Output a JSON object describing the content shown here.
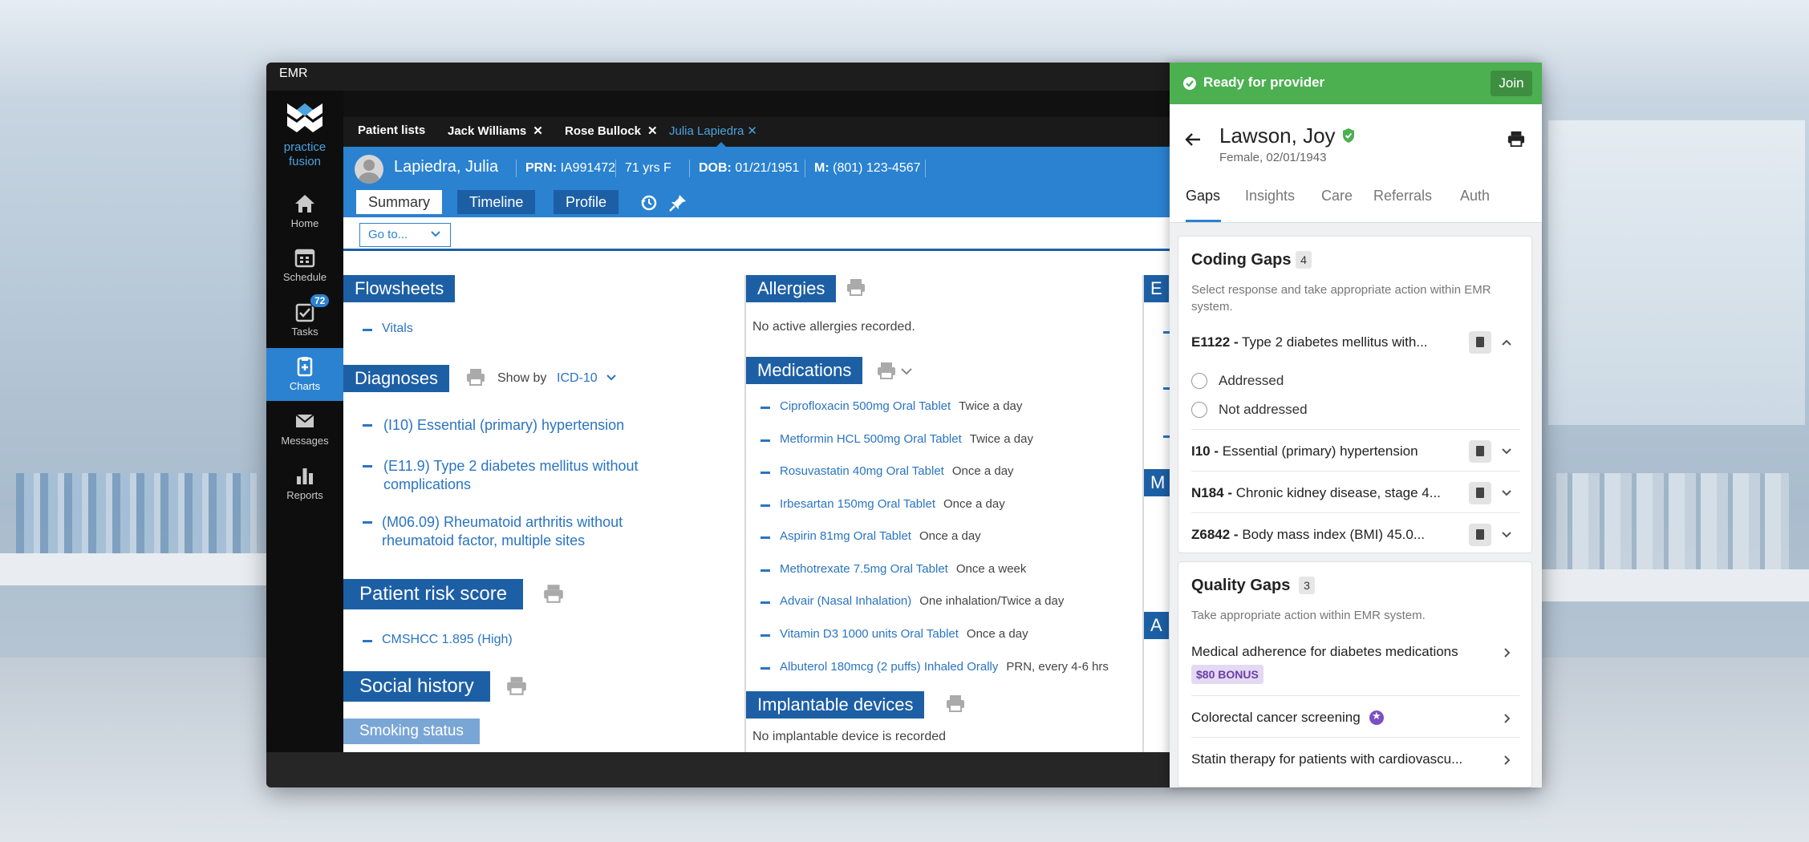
{
  "app": {
    "title": "EMR"
  },
  "logo": {
    "line1": "practice",
    "line2": "fusion"
  },
  "nav": {
    "home": "Home",
    "schedule": "Schedule",
    "tasks": "Tasks",
    "tasks_badge": "72",
    "charts": "Charts",
    "messages": "Messages",
    "reports": "Reports"
  },
  "tabs": [
    {
      "label": "Patient lists"
    },
    {
      "label": "Jack Williams"
    },
    {
      "label": "Rose Bullock"
    },
    {
      "label": "Julia Lapiedra"
    }
  ],
  "patient": {
    "name": "Lapiedra, Julia",
    "prn_label": "PRN:",
    "prn": "IA991472",
    "age": "71 yrs F",
    "dob_label": "DOB:",
    "dob": "01/21/1951",
    "mobile_label": "M:",
    "mobile": "(801) 123-4567"
  },
  "subtabs": {
    "summary": "Summary",
    "timeline": "Timeline",
    "profile": "Profile"
  },
  "goto": {
    "label": "Go to..."
  },
  "flowsheets": {
    "title": "Flowsheets",
    "items": [
      "Vitals"
    ]
  },
  "diagnoses": {
    "title": "Diagnoses",
    "show_by_label": "Show by",
    "show_by_value": "ICD-10",
    "items": [
      {
        "line1": "(I10) Essential (primary) hypertension",
        "line2": ""
      },
      {
        "line1": "(E11.9) Type 2 diabetes mellitus without",
        "line2": "complications"
      },
      {
        "line1": "(M06.09) Rheumatoid arthritis without",
        "line2": "rheumatoid factor, multiple sites"
      }
    ]
  },
  "risk": {
    "title": "Patient risk score",
    "items": [
      "CMSHCC 1.895 (High)"
    ]
  },
  "social": {
    "title": "Social history",
    "smoking": "Smoking status"
  },
  "allergies": {
    "title": "Allergies",
    "empty": "No active allergies recorded."
  },
  "medications": {
    "title": "Medications",
    "items": [
      {
        "name": "Ciprofloxacin 500mg Oral Tablet",
        "freq": "Twice a day"
      },
      {
        "name": "Metformin HCL 500mg Oral Tablet",
        "freq": "Twice a day"
      },
      {
        "name": "Rosuvastatin 40mg Oral Tablet",
        "freq": "Once a day"
      },
      {
        "name": "Irbesartan 150mg Oral Tablet",
        "freq": "Once a day"
      },
      {
        "name": "Aspirin 81mg Oral Tablet",
        "freq": "Once a day"
      },
      {
        "name": "Methotrexate 7.5mg Oral Tablet",
        "freq": "Once a week"
      },
      {
        "name": "Advair (Nasal Inhalation)",
        "freq": "One inhalation/Twice a day"
      },
      {
        "name": "Vitamin D3 1000 units Oral Tablet",
        "freq": "Once a day"
      },
      {
        "name": "Albuterol 180mcg (2 puffs) Inhaled Orally",
        "freq": "PRN, every 4-6 hrs"
      }
    ]
  },
  "implantable": {
    "title": "Implantable devices",
    "empty": "No implantable device is recorded"
  },
  "col3": {
    "head1": "E",
    "head2": "M",
    "head3": "A"
  },
  "panel": {
    "status": "Ready for provider",
    "join": "Join",
    "name": "Lawson, Joy",
    "sub": "Female, 02/01/1943",
    "tabs": [
      "Gaps",
      "Insights",
      "Care",
      "Referrals",
      "Auth"
    ],
    "coding": {
      "title": "Coding Gaps",
      "count": "4",
      "desc": "Select response and take appropriate action within EMR system.",
      "items": [
        {
          "code": "E1122 -",
          "text": "Type 2 diabetes mellitus with..."
        },
        {
          "code": "I10 -",
          "text": "Essential (primary) hypertension"
        },
        {
          "code": "N184 -",
          "text": "Chronic kidney disease, stage 4..."
        },
        {
          "code": "Z6842 -",
          "text": "Body mass index (BMI) 45.0..."
        }
      ],
      "options": [
        "Addressed",
        "Not addressed"
      ]
    },
    "quality": {
      "title": "Quality Gaps",
      "count": "3",
      "desc": "Take appropriate action within EMR system.",
      "items": [
        {
          "text": "Medical adherence for diabetes medications",
          "bonus": "$80 BONUS"
        },
        {
          "text": "Colorectal cancer screening"
        },
        {
          "text": "Statin therapy for patients with cardiovascu..."
        }
      ]
    }
  },
  "colors": {
    "accent": "#2a82d0",
    "section": "#1d5fa5",
    "status_green": "#4caf50",
    "bonus_bg": "#e4d9f3"
  }
}
